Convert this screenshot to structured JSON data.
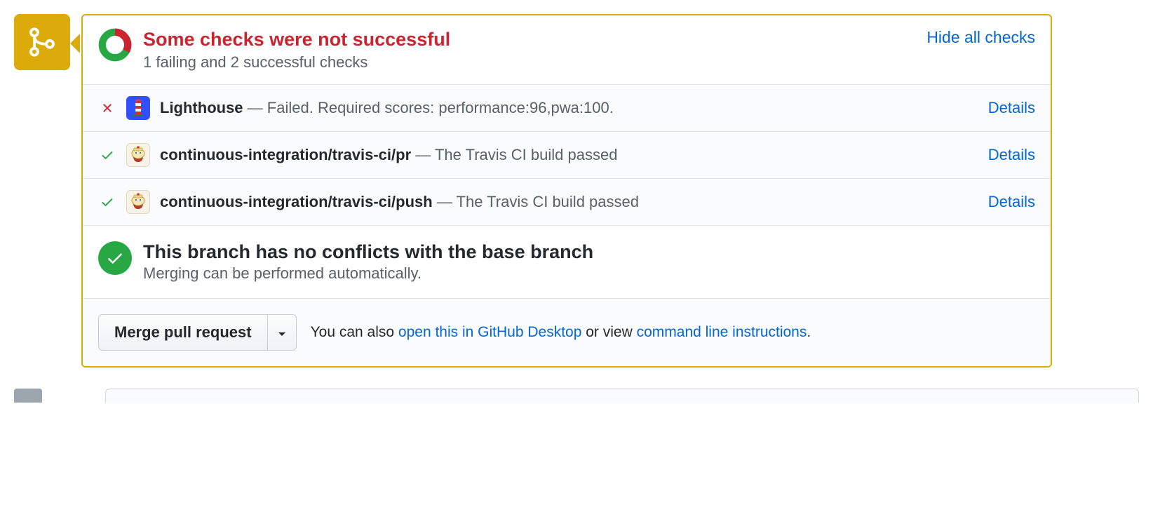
{
  "status": {
    "title": "Some checks were not successful",
    "subtitle": "1 failing and 2 successful checks",
    "hide_link": "Hide all checks"
  },
  "checks": [
    {
      "status": "fail",
      "avatar": "lighthouse",
      "name": "Lighthouse",
      "description": "Failed. Required scores: performance:96,pwa:100.",
      "details": "Details"
    },
    {
      "status": "pass",
      "avatar": "travis",
      "name": "continuous-integration/travis-ci/pr",
      "description": "The Travis CI build passed",
      "details": "Details"
    },
    {
      "status": "pass",
      "avatar": "travis",
      "name": "continuous-integration/travis-ci/push",
      "description": "The Travis CI build passed",
      "details": "Details"
    }
  ],
  "conflict": {
    "title": "This branch has no conflicts with the base branch",
    "subtitle": "Merging can be performed automatically."
  },
  "merge": {
    "button": "Merge pull request",
    "hint_prefix": "You can also ",
    "link1": "open this in GitHub Desktop",
    "hint_mid": " or view ",
    "link2": "command line instructions",
    "hint_suffix": "."
  }
}
